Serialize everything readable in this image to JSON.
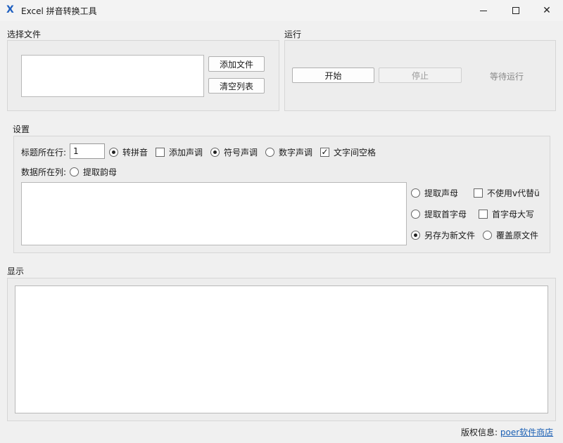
{
  "window": {
    "title": "Excel 拼音转换工具",
    "icon": "x-icon",
    "controls": {
      "minimize": "minimize",
      "maximize": "maximize",
      "close": "close"
    }
  },
  "file_group": {
    "label": "选择文件",
    "add_button": "添加文件",
    "clear_button": "清空列表"
  },
  "run_group": {
    "label": "运行",
    "start_button": "开始",
    "stop_button": "停止",
    "status": "等待运行"
  },
  "settings": {
    "label": "设置",
    "title_row_label": "标题所在行:",
    "title_row_value": "1",
    "data_col_label": "数据所在列:",
    "options": {
      "to_pinyin": "转拼音",
      "add_tone": "添加声调",
      "symbol_tone": "符号声调",
      "number_tone": "数字声调",
      "word_space": "文字间空格",
      "extract_final": "提取韵母",
      "extract_initial": "提取声母",
      "no_v_for_u": "不使用v代替ü",
      "extract_first_letter": "提取首字母",
      "first_letter_upper": "首字母大写",
      "save_as_new": "另存为新文件",
      "overwrite": "覆盖原文件"
    },
    "checkmark": "✓"
  },
  "display": {
    "label": "显示"
  },
  "footer": {
    "copyright_label": "版权信息:",
    "link_text": "poer软件商店"
  }
}
